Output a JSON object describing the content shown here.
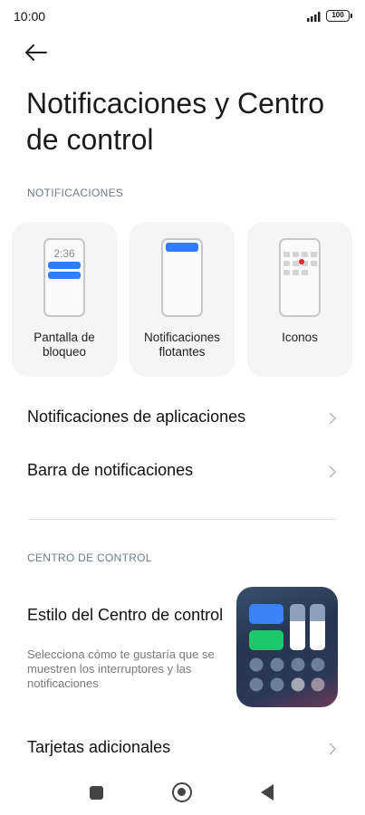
{
  "status_bar": {
    "time": "10:00",
    "battery": "100"
  },
  "page": {
    "title": "Notificaciones y Centro de control"
  },
  "notifications_section": {
    "label": "NOTIFICACIONES",
    "cards": [
      {
        "label": "Pantalla de bloqueo",
        "preview_time": "2:36"
      },
      {
        "label": "Notificaciones flotantes"
      },
      {
        "label": "Iconos"
      }
    ]
  },
  "rows": {
    "app_notifications": "Notificaciones de aplicaciones",
    "notification_bar": "Barra de notificaciones"
  },
  "control_center_section": {
    "label": "CENTRO DE CONTROL",
    "style_title": "Estilo del Centro de control",
    "style_description": "Selecciona cómo te gustaría que se muestren los interruptores y las notificaciones",
    "extra_cards": "Tarjetas adicionales"
  },
  "colors": {
    "accent": "#2e7dfb",
    "green": "#18c86a",
    "dot": "#e0282e"
  }
}
